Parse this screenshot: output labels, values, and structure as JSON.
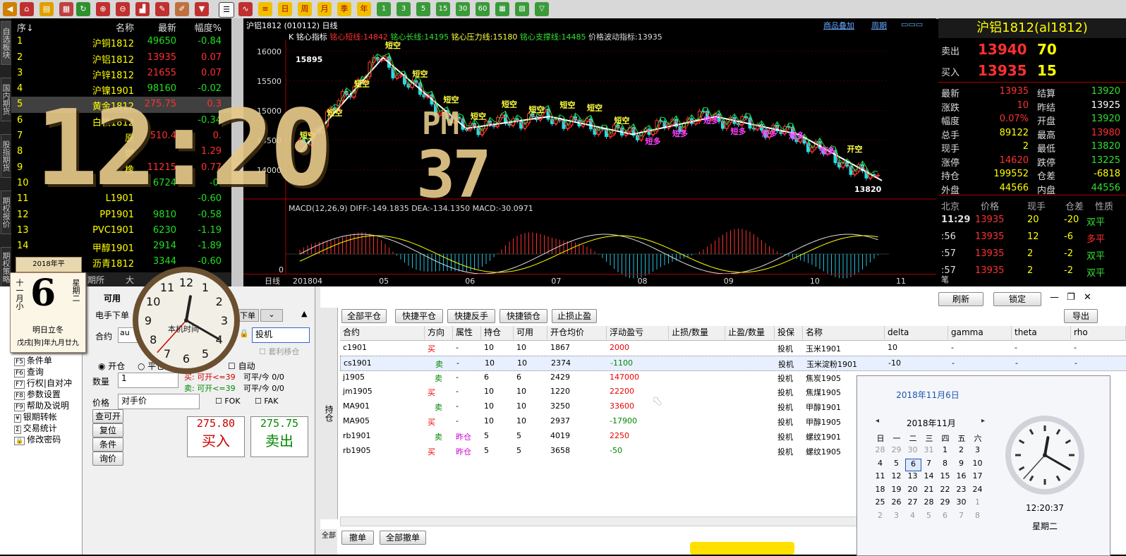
{
  "toolbar": {
    "green_buttons": [
      "1",
      "3",
      "5",
      "15",
      "30",
      "60"
    ],
    "period_buttons": [
      "日",
      "周",
      "月",
      "季",
      "年"
    ]
  },
  "vtabs": [
    "自选板块",
    "国内期货",
    "股指期货",
    "期权报价",
    "期权策略"
  ],
  "quote_list": {
    "headers": {
      "no": "序↓",
      "name": "名称",
      "last": "最新",
      "chg": "幅度%"
    },
    "rows": [
      {
        "no": "1",
        "name": "沪铜1812",
        "last": "49650",
        "chg": "-0.84",
        "dir": "dn"
      },
      {
        "no": "2",
        "name": "沪铝1812",
        "last": "13935",
        "chg": "0.07",
        "dir": "up"
      },
      {
        "no": "3",
        "name": "沪锌1812",
        "last": "21655",
        "chg": "0.07",
        "dir": "up"
      },
      {
        "no": "4",
        "name": "沪镍1901",
        "last": "98160",
        "chg": "-0.02",
        "dir": "dn"
      },
      {
        "no": "5",
        "name": "黄金1812",
        "last": "275.75",
        "chg": "0.3",
        "dir": "up"
      },
      {
        "no": "6",
        "name": "白银1812",
        "last": "",
        "chg": "-0.34",
        "dir": "dn"
      },
      {
        "no": "7",
        "name": "原",
        "last": "510.4",
        "chg": "0.",
        "dir": "up"
      },
      {
        "no": "8",
        "name": "燃",
        "last": "",
        "chg": "1.29",
        "dir": "up"
      },
      {
        "no": "9",
        "name": "橡",
        "last": "11215",
        "chg": "0.77",
        "dir": "up"
      },
      {
        "no": "10",
        "name": "",
        "last": "6724",
        "chg": "-0.",
        "dir": "dn"
      },
      {
        "no": "11",
        "name": "L1901",
        "last": "",
        "chg": "-0.60",
        "dir": "dn"
      },
      {
        "no": "12",
        "name": "PP1901",
        "last": "9810",
        "chg": "-0.58",
        "dir": "dn"
      },
      {
        "no": "13",
        "name": "PVC1901",
        "last": "6230",
        "chg": "-1.19",
        "dir": "dn"
      },
      {
        "no": "14",
        "name": "甲醇1901",
        "last": "2914",
        "chg": "-1.89",
        "dir": "dn"
      },
      {
        "no": "15",
        "name": "沥青1812",
        "last": "3344",
        "chg": "-0.60",
        "dir": "dn"
      }
    ],
    "tabs": [
      "期所",
      "大"
    ]
  },
  "chart": {
    "symbol_line": "沪铝1812 (010112) 日线",
    "top_right": [
      "商品叠加",
      "周期"
    ],
    "indicator_line": {
      "k": "K",
      "name": "铭心指标",
      "short": "铭心短线:14842",
      "long": "铭心长线:14195",
      "press": "铭心压力线:15180",
      "support": "铭心支撑线:14485",
      "wave": "价格波动指标:13935"
    },
    "high_label": "15895",
    "low_label": "13820",
    "macd_line": "MACD(12,26,9) DIFF:-149.1835 DEA:-134.1350 MACD:-30.0971",
    "macd_zero": "0",
    "date_axis": [
      "日线",
      "201804",
      "05",
      "06",
      "07",
      "08",
      "09",
      "10",
      "11"
    ],
    "signals": [
      "短空",
      "短空",
      "短空",
      "短空",
      "短空",
      "短空",
      "短空",
      "短空",
      "短空",
      "短空",
      "短空",
      "短空",
      "短多",
      "短多",
      "短多",
      "短多",
      "短多",
      "短多",
      "短多",
      "开空"
    ]
  },
  "chart_data": {
    "type": "line",
    "title": "沪铝1812 日线",
    "xlabel": "",
    "ylabel": "",
    "x": [
      "201804",
      "05",
      "06",
      "07",
      "08",
      "09",
      "10",
      "11"
    ],
    "ylim": [
      13700,
      16200
    ],
    "yticks": [
      14000,
      14500,
      15000,
      15500,
      16000
    ],
    "series": [
      {
        "name": "铭心短线",
        "values": [
          14300,
          15895,
          14700,
          14900,
          14600,
          14900,
          14600,
          13820
        ]
      }
    ]
  },
  "right_panel": {
    "title": "沪铝1812(al1812)",
    "sell": {
      "label": "卖出",
      "price": "13940",
      "vol": "70"
    },
    "buy": {
      "label": "买入",
      "price": "13935",
      "vol": "15"
    },
    "stats": [
      [
        "最新",
        "13935",
        "结算",
        "13920"
      ],
      [
        "涨跌",
        "10",
        "昨结",
        "13925"
      ],
      [
        "幅度",
        "0.07%",
        "开盘",
        "13920"
      ],
      [
        "总手",
        "89122",
        "最高",
        "13980"
      ],
      [
        "现手",
        "2",
        "最低",
        "13820"
      ],
      [
        "涨停",
        "14620",
        "跌停",
        "13225"
      ],
      [
        "持仓",
        "199552",
        "仓差",
        "-6818"
      ],
      [
        "外盘",
        "44566",
        "内盘",
        "44556"
      ]
    ],
    "ticks_header": [
      "北京",
      "价格",
      "现手",
      "仓差",
      "性质"
    ],
    "ticks": [
      [
        "11:29",
        "13935",
        "20",
        "-20",
        "双平"
      ],
      [
        ":56",
        "13935",
        "12",
        "-6",
        "多平"
      ],
      [
        ":57",
        "13935",
        "2",
        "-2",
        "双平"
      ],
      [
        ":57",
        "13935",
        "2",
        "-2",
        "双平"
      ]
    ],
    "bottom_tab": "笔"
  },
  "calendar_widget": {
    "year_line": "2018年平",
    "lunar_month": "十一月小",
    "day": "6",
    "weekday": "星期二",
    "note": "明日立冬",
    "ganzhi": "戊戌[狗]年九月廿九"
  },
  "analog_clock": {
    "label": "本机时间"
  },
  "digital_clock": {
    "time": "12:20",
    "pm": "PM",
    "sec": "37"
  },
  "order_panel": {
    "menu": [
      {
        "key": "F5",
        "label": "条件单"
      },
      {
        "key": "F6",
        "label": "查询"
      },
      {
        "key": "F7",
        "label": "行权|自对冲"
      },
      {
        "key": "F8",
        "label": "参数设置"
      },
      {
        "key": "F9",
        "label": "帮助及说明"
      },
      {
        "key": "¥",
        "label": "银期转帐"
      },
      {
        "key": "Σ",
        "label": "交易统计"
      },
      {
        "key": "🔒",
        "label": "修改密码"
      }
    ],
    "tab_available": "可用",
    "tab_quick": "电手下单",
    "tab_next": "下单",
    "contract_label": "合约",
    "contract_value": "au",
    "hedge": "投机",
    "arb_checkbox": "套利移仓",
    "open": "开仓",
    "close": "平仓",
    "auto": "自动",
    "qty_label": "数量",
    "qty": "1",
    "buy_info": "买: 可开<=39",
    "buy_info2": "可平/今 0/0",
    "sell_info": "卖: 可开<=39",
    "sell_info2": "可平/今 0/0",
    "price_label": "价格",
    "price_mode": "对手价",
    "fok": "FOK",
    "fak": "FAK",
    "btn_query": "查可开",
    "btn_reset": "复位",
    "btn_cond": "条件",
    "btn_ask": "询价",
    "buy_price": "275.80",
    "buy_label": "买入",
    "sell_price": "275.75",
    "sell_label": "卖出"
  },
  "positions": {
    "side_tab": "持仓",
    "actions": [
      "全部平仓",
      "快捷平仓",
      "快捷反手",
      "快捷锁仓",
      "止损止盈"
    ],
    "top_right_buttons": [
      "刷新",
      "锁定",
      "导出"
    ],
    "columns": [
      "合约",
      "方向",
      "属性",
      "持仓",
      "可用",
      "开仓均价",
      "浮动盈亏",
      "止损/数量",
      "止盈/数量",
      "投保",
      "名称",
      "delta",
      "gamma",
      "theta",
      "rho"
    ],
    "rows": [
      {
        "c": "c1901",
        "dir": "买",
        "attr": "-",
        "pos": "10",
        "avail": "10",
        "avg": "1867",
        "pnl": "2000",
        "hedge": "投机",
        "name": "玉米1901",
        "delta": "10",
        "gamma": "-",
        "theta": "-",
        "rho": "-"
      },
      {
        "c": "cs1901",
        "dir": "卖",
        "attr": "-",
        "pos": "10",
        "avail": "10",
        "avg": "2374",
        "pnl": "-1100",
        "hedge": "投机",
        "name": "玉米淀粉1901",
        "delta": "-10",
        "gamma": "-",
        "theta": "-",
        "rho": "-"
      },
      {
        "c": "j1905",
        "dir": "卖",
        "attr": "-",
        "pos": "6",
        "avail": "6",
        "avg": "2429",
        "pnl": "147000",
        "hedge": "投机",
        "name": "焦炭1905",
        "delta": "",
        "gamma": "",
        "theta": "",
        "rho": ""
      },
      {
        "c": "jm1905",
        "dir": "买",
        "attr": "-",
        "pos": "10",
        "avail": "10",
        "avg": "1220",
        "pnl": "22200",
        "hedge": "投机",
        "name": "焦煤1905",
        "delta": "",
        "gamma": "",
        "theta": "",
        "rho": ""
      },
      {
        "c": "MA901",
        "dir": "卖",
        "attr": "-",
        "pos": "10",
        "avail": "10",
        "avg": "3250",
        "pnl": "33600",
        "hedge": "投机",
        "name": "甲醇1901",
        "delta": "",
        "gamma": "",
        "theta": "",
        "rho": ""
      },
      {
        "c": "MA905",
        "dir": "买",
        "attr": "-",
        "pos": "10",
        "avail": "10",
        "avg": "2937",
        "pnl": "-17900",
        "hedge": "投机",
        "name": "甲醇1905",
        "delta": "",
        "gamma": "",
        "theta": "",
        "rho": ""
      },
      {
        "c": "rb1901",
        "dir": "卖",
        "attr": "昨仓",
        "pos": "5",
        "avail": "5",
        "avg": "4019",
        "pnl": "2250",
        "hedge": "投机",
        "name": "螺纹1901",
        "delta": "",
        "gamma": "",
        "theta": "",
        "rho": ""
      },
      {
        "c": "rb1905",
        "dir": "买",
        "attr": "昨仓",
        "pos": "5",
        "avail": "5",
        "avg": "3658",
        "pnl": "-50",
        "hedge": "投机",
        "name": "螺纹1905",
        "delta": "",
        "gamma": "",
        "theta": "",
        "rho": ""
      }
    ],
    "bottom_buttons": [
      "撤单",
      "全部撤单"
    ],
    "bottom_tab": "全部"
  },
  "date_popup": {
    "title": "2018年11月6日",
    "month": "2018年11月",
    "weekdays": [
      "日",
      "一",
      "二",
      "三",
      "四",
      "五",
      "六"
    ],
    "weeks": [
      [
        "28",
        "29",
        "30",
        "31",
        "1",
        "2",
        "3"
      ],
      [
        "4",
        "5",
        "6",
        "7",
        "8",
        "9",
        "10"
      ],
      [
        "11",
        "12",
        "13",
        "14",
        "15",
        "16",
        "17"
      ],
      [
        "18",
        "19",
        "20",
        "21",
        "22",
        "23",
        "24"
      ],
      [
        "25",
        "26",
        "27",
        "28",
        "29",
        "30",
        "1"
      ],
      [
        "2",
        "3",
        "4",
        "5",
        "6",
        "7",
        "8"
      ]
    ],
    "time": "12:20:37",
    "weekday": "星期二"
  }
}
